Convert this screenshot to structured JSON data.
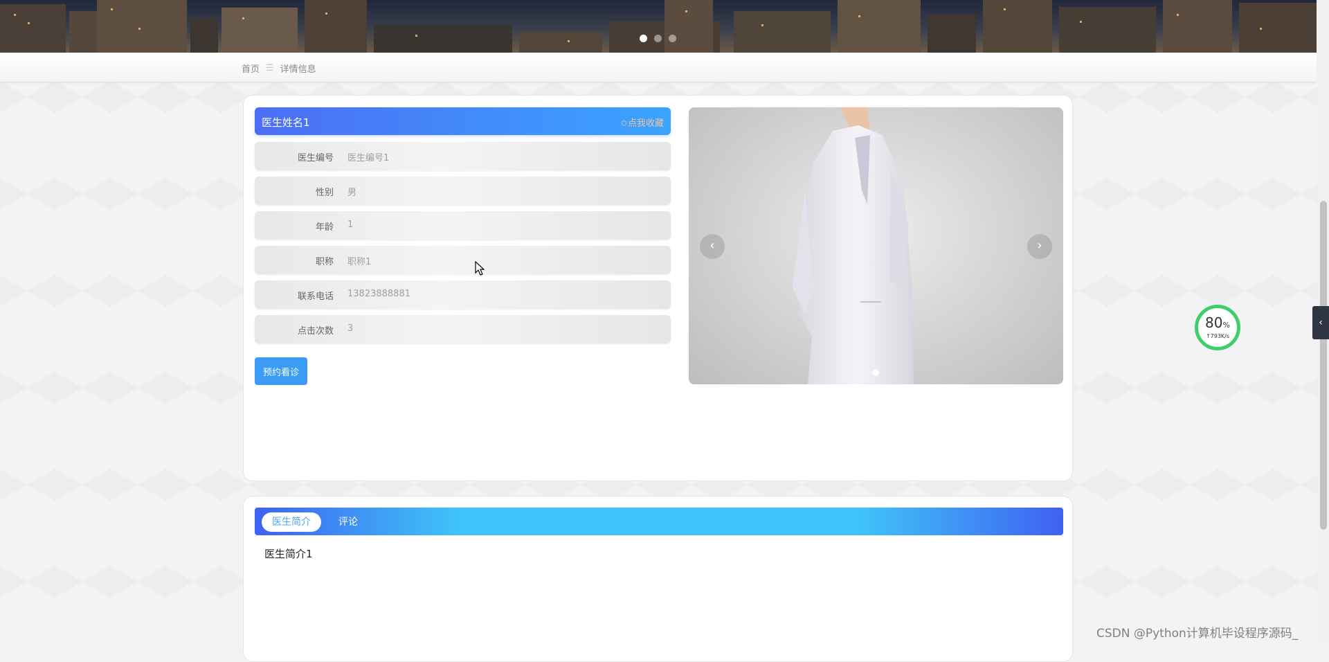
{
  "breadcrumb": {
    "home": "首页",
    "separator": "☰",
    "current": "详情信息"
  },
  "banner": {
    "slides": 3,
    "active_index": 0
  },
  "doctor": {
    "name": "医生姓名1",
    "favorite_label": "✩点我收藏",
    "fields": [
      {
        "label": "医生编号",
        "value": "医生编号1"
      },
      {
        "label": "性别",
        "value": "男"
      },
      {
        "label": "年龄",
        "value": "1"
      },
      {
        "label": "职称",
        "value": "职称1"
      },
      {
        "label": "联系电话",
        "value": "13823888881"
      },
      {
        "label": "点击次数",
        "value": "3"
      }
    ],
    "book_button": "预约看诊"
  },
  "carousel": {
    "prev_icon": "‹",
    "next_icon": "›",
    "slides": 1
  },
  "tabs": [
    {
      "label": "医生简介",
      "active": true
    },
    {
      "label": "评论",
      "active": false
    }
  ],
  "intro_text": "医生简介1",
  "speed_widget": {
    "percent": "80",
    "unit": "%",
    "rate": "↑793K/s"
  },
  "side_toggle_icon": "‹",
  "watermark": "CSDN @Python计算机毕设程序源码_",
  "colors": {
    "accent_blue": "#3c9cf5",
    "title_gradient_start": "#4c6ef5",
    "title_gradient_end": "#3aa4ff",
    "progress_green": "#3ecf6a"
  }
}
